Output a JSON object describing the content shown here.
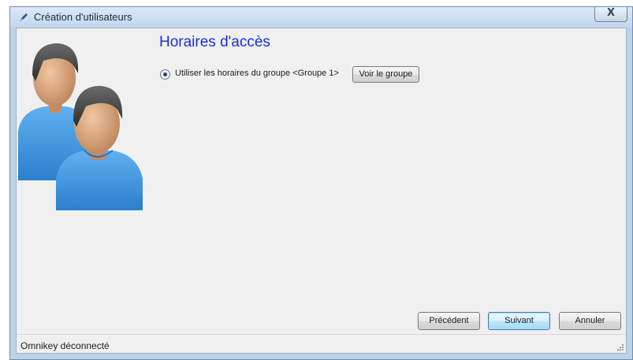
{
  "window": {
    "title": "Création d'utilisateurs",
    "close_label": "X"
  },
  "page": {
    "title": "Horaires d'accès"
  },
  "access_hours": {
    "option_label": "Utiliser les horaires du groupe <Groupe 1>",
    "option_selected": true,
    "view_group_button": "Voir le groupe"
  },
  "footer": {
    "prev_button": "Précédent",
    "next_button": "Suivant",
    "cancel_button": "Annuler"
  },
  "status": {
    "text": "Omnikey déconnecté"
  },
  "icons": {
    "app": "pen-icon",
    "illustration": "users-icon",
    "close": "close-icon",
    "grip": "resize-grip-icon"
  },
  "colors": {
    "title_blue": "#1b2ee0",
    "default_button_border": "#3c7fb1",
    "shirt_blue": "#3c96de"
  }
}
